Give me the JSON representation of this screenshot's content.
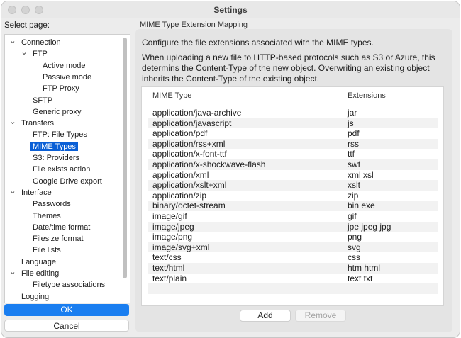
{
  "window": {
    "title": "Settings"
  },
  "sidebar": {
    "label": "Select page:",
    "items": [
      {
        "label": "Connection",
        "level": 1,
        "expanded": true
      },
      {
        "label": "FTP",
        "level": 2,
        "expanded": true
      },
      {
        "label": "Active mode",
        "level": 3
      },
      {
        "label": "Passive mode",
        "level": 3
      },
      {
        "label": "FTP Proxy",
        "level": 3
      },
      {
        "label": "SFTP",
        "level": 2
      },
      {
        "label": "Generic proxy",
        "level": 2
      },
      {
        "label": "Transfers",
        "level": 1,
        "expanded": true
      },
      {
        "label": "FTP: File Types",
        "level": 2
      },
      {
        "label": "MIME Types",
        "level": 2,
        "selected": true
      },
      {
        "label": "S3: Providers",
        "level": 2
      },
      {
        "label": "File exists action",
        "level": 2
      },
      {
        "label": "Google Drive export",
        "level": 2
      },
      {
        "label": "Interface",
        "level": 1,
        "expanded": true
      },
      {
        "label": "Passwords",
        "level": 2
      },
      {
        "label": "Themes",
        "level": 2
      },
      {
        "label": "Date/time format",
        "level": 2
      },
      {
        "label": "Filesize format",
        "level": 2
      },
      {
        "label": "File lists",
        "level": 2
      },
      {
        "label": "Language",
        "level": 1
      },
      {
        "label": "File editing",
        "level": 1,
        "expanded": true
      },
      {
        "label": "Filetype associations",
        "level": 2
      },
      {
        "label": "Logging",
        "level": 1
      }
    ]
  },
  "buttons": {
    "ok": "OK",
    "cancel": "Cancel",
    "add": "Add",
    "remove": "Remove"
  },
  "panel": {
    "title": "MIME Type Extension Mapping",
    "description1": "Configure the file extensions associated with the MIME types.",
    "description2": "When uploading a new file to HTTP-based protocols such as S3 or Azure, this determins the Content-Type of the new object. Overwriting an existing object inherits the Content-Type of the existing object."
  },
  "table": {
    "columns": [
      "MIME Type",
      "Extensions"
    ],
    "rows": [
      [
        "application/java-archive",
        "jar"
      ],
      [
        "application/javascript",
        "js"
      ],
      [
        "application/pdf",
        "pdf"
      ],
      [
        "application/rss+xml",
        "rss"
      ],
      [
        "application/x-font-ttf",
        "ttf"
      ],
      [
        "application/x-shockwave-flash",
        "swf"
      ],
      [
        "application/xml",
        "xml xsl"
      ],
      [
        "application/xslt+xml",
        "xslt"
      ],
      [
        "application/zip",
        "zip"
      ],
      [
        "binary/octet-stream",
        "bin exe"
      ],
      [
        "image/gif",
        "gif"
      ],
      [
        "image/jpeg",
        "jpe jpeg jpg"
      ],
      [
        "image/png",
        "png"
      ],
      [
        "image/svg+xml",
        "svg"
      ],
      [
        "text/css",
        "css"
      ],
      [
        "text/html",
        "htm html"
      ],
      [
        "text/plain",
        "text txt"
      ]
    ]
  },
  "colors": {
    "accent": "#1a7ef0",
    "selection": "#0a5fd6"
  }
}
